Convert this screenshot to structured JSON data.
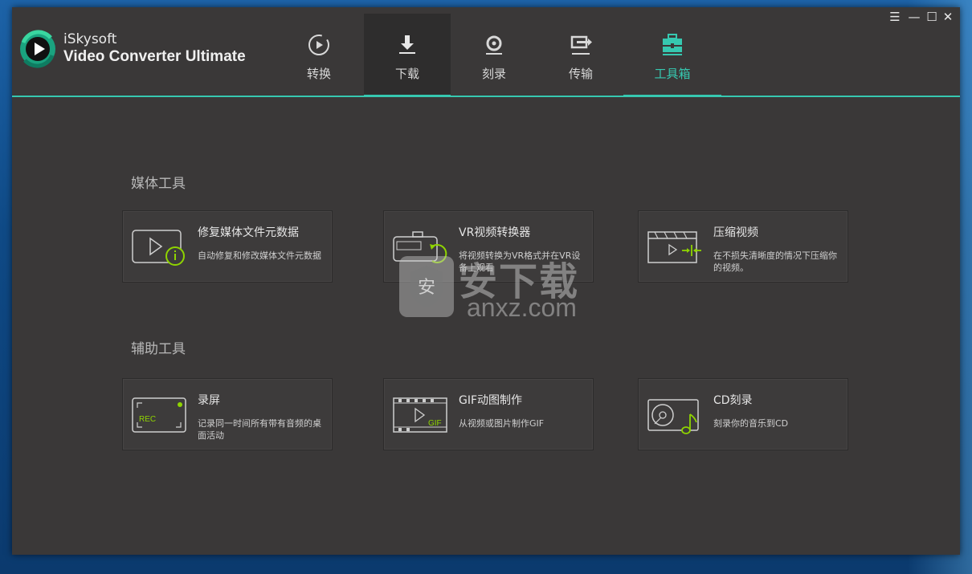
{
  "app": {
    "brand_name": "iSkysoft",
    "product_name": "Video Converter Ultimate"
  },
  "tabs": [
    {
      "label": "转换",
      "icon": "convert-icon"
    },
    {
      "label": "下载",
      "icon": "download-icon"
    },
    {
      "label": "刻录",
      "icon": "burn-icon"
    },
    {
      "label": "传输",
      "icon": "transfer-icon"
    },
    {
      "label": "工具箱",
      "icon": "toolbox-icon"
    }
  ],
  "window_controls": {
    "menu": "☰",
    "minimize": "—",
    "maximize": "☐",
    "close": "✕"
  },
  "sections": {
    "media_tools": "媒体工具",
    "assist_tools": "辅助工具"
  },
  "cards": {
    "fix_metadata": {
      "title": "修复媒体文件元数据",
      "desc": "自动修复和修改媒体文件元数据"
    },
    "vr_converter": {
      "title": "VR视频转换器",
      "desc": "将视频转换为VR格式并在VR设备上观看"
    },
    "compress_video": {
      "title": "压缩视频",
      "desc": "在不损失清晰度的情况下压缩你的视频。"
    },
    "screen_record": {
      "title": "录屏",
      "desc": "记录同一时间所有带有音频的桌面活动",
      "icon_text": "REC"
    },
    "gif_maker": {
      "title": "GIF动图制作",
      "desc": "从视频或图片制作GIF",
      "icon_text": "GIF"
    },
    "cd_burn": {
      "title": "CD刻录",
      "desc": "刻录你的音乐到CD"
    }
  },
  "watermark": {
    "cn": "安下载",
    "url": "anxz.com",
    "shield": "安"
  },
  "colors": {
    "accent": "#36c8b0",
    "icon_green": "#8fd400",
    "bg": "#3a3838"
  }
}
